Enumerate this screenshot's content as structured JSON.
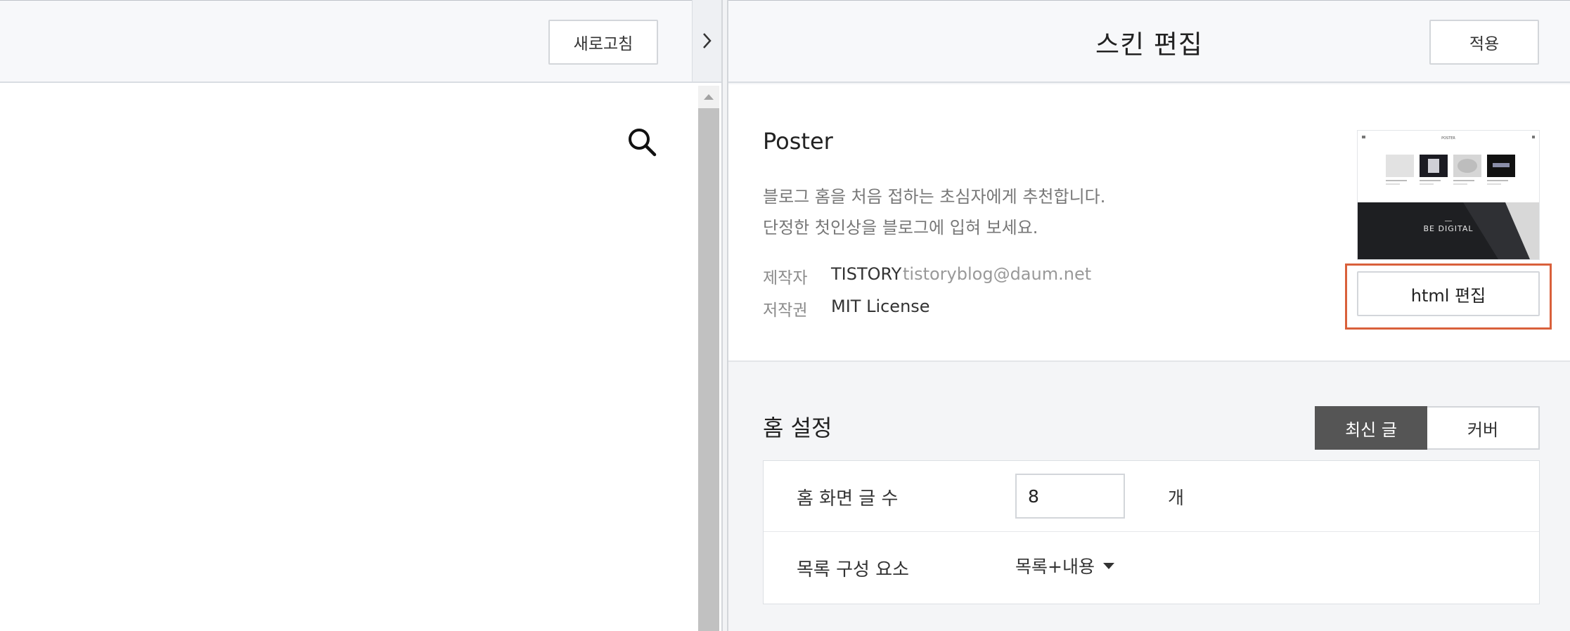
{
  "preview": {
    "refresh_label": "새로고침"
  },
  "panel": {
    "title": "스킨 편집",
    "apply_label": "적용"
  },
  "skin": {
    "name": "Poster",
    "description_line1": "블로그 홈을 처음 접하는 초심자에게 추천합니다.",
    "description_line2": "단정한 첫인상을 블로그에 입혀 보세요.",
    "author_label": "제작자",
    "author_name": "TISTORY",
    "author_email": "tistoryblog@daum.net",
    "license_label": "저작권",
    "license_value": "MIT License",
    "thumbnail_logo": "POSTER",
    "thumbnail_banner": "BE DIGITAL",
    "html_edit_label": "html 편집"
  },
  "home_settings": {
    "title": "홈 설정",
    "toggle_latest": "최신 글",
    "toggle_cover": "커버",
    "active_toggle": "최신 글",
    "post_count_label": "홈 화면 글 수",
    "post_count_value": "8",
    "post_count_unit": "개",
    "list_elements_label": "목록 구성 요소",
    "list_elements_value": "목록+내용"
  },
  "colors": {
    "highlight": "#d9603b",
    "active_toggle_bg": "#555555",
    "panel_bg": "#f4f5f7"
  }
}
